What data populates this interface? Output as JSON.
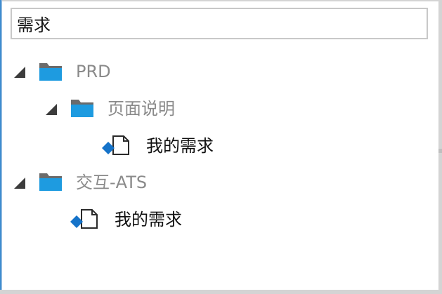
{
  "search": {
    "value": "需求"
  },
  "tree": {
    "nodes": [
      {
        "label": "PRD",
        "type": "folder",
        "expanded": true,
        "icon": "folder-icon"
      },
      {
        "label": "页面说明",
        "type": "folder",
        "expanded": true,
        "icon": "folder-icon"
      },
      {
        "label": "我的需求",
        "type": "page",
        "icon": "page-icon"
      },
      {
        "label": "交互-ATS",
        "type": "folder",
        "expanded": true,
        "icon": "folder-icon"
      },
      {
        "label": "我的需求",
        "type": "page",
        "icon": "page-icon"
      }
    ]
  },
  "colors": {
    "folder_blue": "#1e9be0",
    "folder_tab": "#6b6b6b",
    "diamond_blue": "#1573c9",
    "expander": "#3c3c3c",
    "folder_label": "#8a8a8a",
    "page_label": "#111111"
  }
}
